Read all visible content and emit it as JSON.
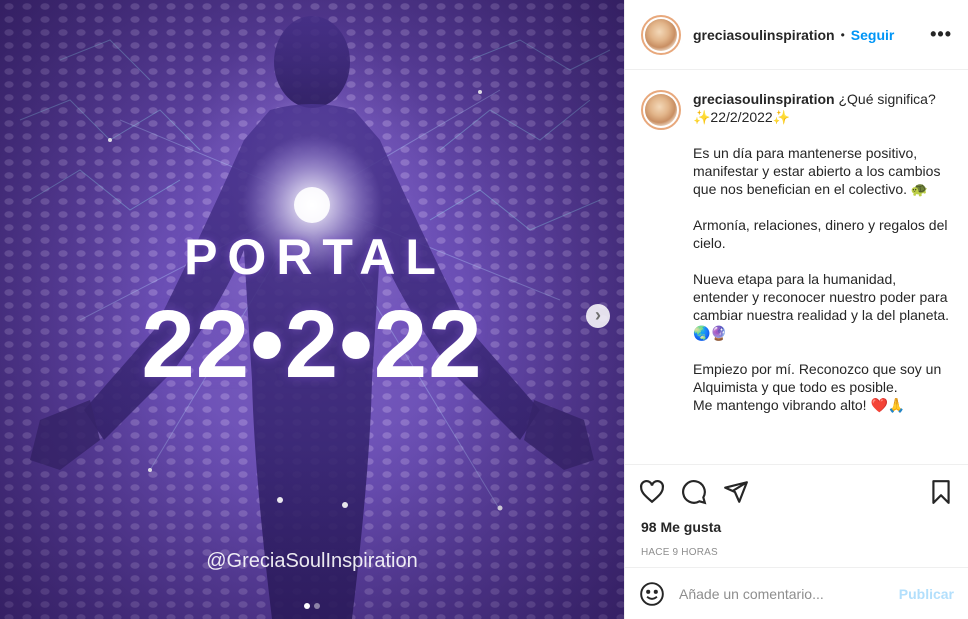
{
  "post": {
    "username": "greciasoulinspiration",
    "separator": "•",
    "follow_label": "Seguir",
    "more_label": "•••"
  },
  "media": {
    "title_word": "PORTAL",
    "title_date": "22•2•22",
    "watermark": "@GreciaSoulInspiration",
    "next_label": "›",
    "dots": 2,
    "active_dot": 0
  },
  "caption": {
    "username": "greciasoulinspiration",
    "text": "¿Qué significa?\n✨22/2/2022✨\n\nEs un día para mantenerse positivo, manifestar y estar abierto a los cambios que nos benefician en el colectivo. 🐢\n\nArmonía, relaciones, dinero y regalos del cielo.\n\nNueva etapa para la humanidad, entender y reconocer nuestro poder para cambiar nuestra realidad y la del planeta.🌏🔮\n\nEmpiezo por mí. Reconozco que soy un Alquimista y que todo es posible.\nMe mantengo vibrando alto! ❤️🙏"
  },
  "stats": {
    "likes": "98 Me gusta",
    "time": "HACE 9 HORAS"
  },
  "comment": {
    "placeholder": "Añade un comentario...",
    "publish_label": "Publicar"
  },
  "icons": {
    "like": "heart-icon",
    "comment": "comment-icon",
    "share": "share-icon",
    "save": "bookmark-icon",
    "emoji": "emoji-icon"
  },
  "colors": {
    "accent": "#0095f6",
    "publish_disabled": "#b2dffc",
    "media_purple": "#6b4fb5"
  }
}
